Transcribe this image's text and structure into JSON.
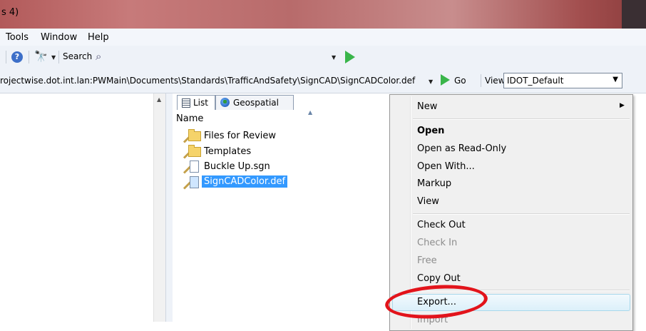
{
  "window": {
    "title": "s 4)"
  },
  "menu": {
    "items": [
      "Tools",
      "Window",
      "Help"
    ]
  },
  "search": {
    "label": "Search"
  },
  "address": {
    "path": "rojectwise.dot.int.lan:PWMain\\Documents\\Standards\\TrafficAndSafety\\SignCAD\\SignCADColor.def",
    "go_label": "Go",
    "view_label": "View",
    "view_value": "IDOT_Default"
  },
  "tabs": [
    {
      "label": "List"
    },
    {
      "label": "Geospatial"
    }
  ],
  "list": {
    "column": "Name",
    "rows": [
      {
        "label": "Files for Review"
      },
      {
        "label": "Templates"
      },
      {
        "label": "Buckle Up.sgn"
      },
      {
        "label": "SignCADColor.def"
      }
    ]
  },
  "context_menu": {
    "new": "New",
    "open": "Open",
    "open_readonly": "Open as Read-Only",
    "open_with": "Open With...",
    "markup": "Markup",
    "view": "View",
    "check_out": "Check Out",
    "check_in": "Check In",
    "free": "Free",
    "copy_out": "Copy Out",
    "export": "Export...",
    "import": "Import"
  },
  "colors": {
    "selection": "#3399ff",
    "highlight_ellipse": "#e2141b",
    "go_arrow": "#39b54a"
  }
}
